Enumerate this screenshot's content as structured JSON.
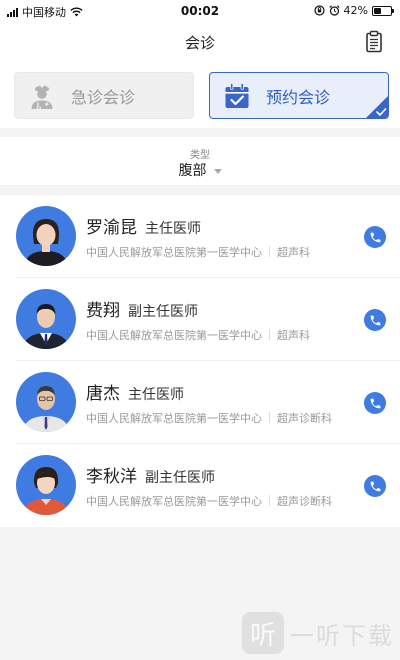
{
  "status_bar": {
    "carrier": "中国移动",
    "time": "00:02",
    "battery": "42%",
    "battery_level": 0.42
  },
  "nav": {
    "title": "会诊",
    "action_icon": "clipboard-icon"
  },
  "tabs": [
    {
      "label": "急诊会诊",
      "icon": "doctor-icon",
      "selected": false
    },
    {
      "label": "预约会诊",
      "icon": "calendar-check-icon",
      "selected": true
    }
  ],
  "filter": {
    "label": "类型",
    "value": "腹部"
  },
  "doctors": [
    {
      "name": "罗渝昆",
      "title": "主任医师",
      "hospital": "中国人民解放军总医院第一医学中心",
      "department": "超声科"
    },
    {
      "name": "费翔",
      "title": "副主任医师",
      "hospital": "中国人民解放军总医院第一医学中心",
      "department": "超声科"
    },
    {
      "name": "唐杰",
      "title": "主任医师",
      "hospital": "中国人民解放军总医院第一医学中心",
      "department": "超声诊断科"
    },
    {
      "name": "李秋洋",
      "title": "副主任医师",
      "hospital": "中国人民解放军总医院第一医学中心",
      "department": "超声诊断科"
    }
  ],
  "watermark": {
    "logo": "听",
    "text": "一听下载"
  },
  "colors": {
    "accent": "#3f7be0",
    "tab_selected_bg": "#e9effa",
    "tab_selected_text": "#2f5fc4"
  }
}
